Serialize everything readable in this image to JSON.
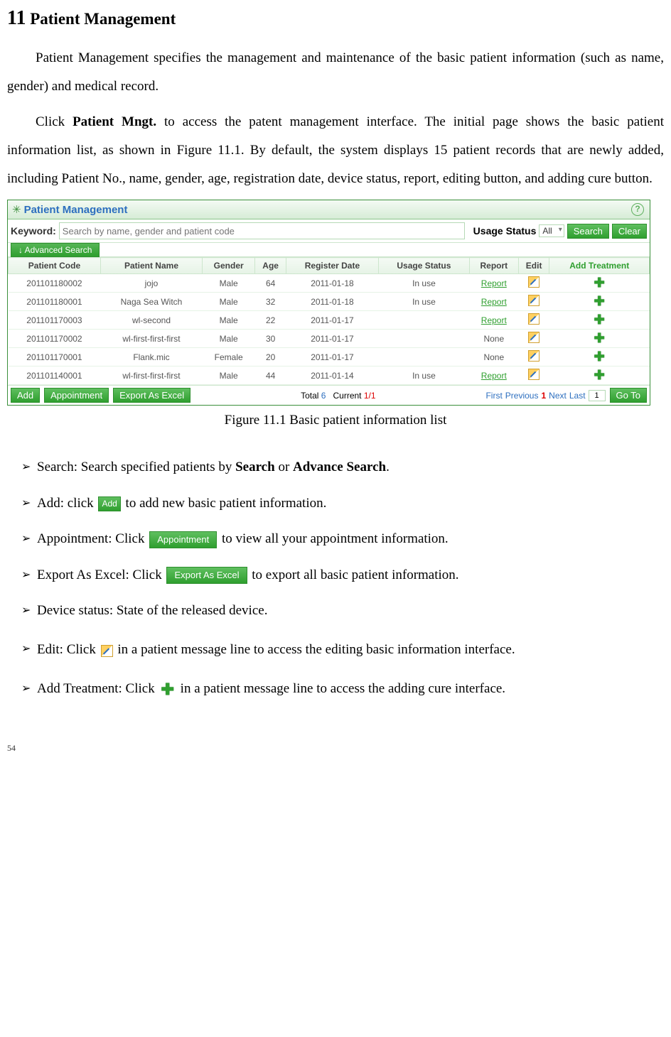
{
  "section": {
    "number": "11",
    "title": "Patient Management"
  },
  "para1": "Patient Management specifies the management and maintenance of the basic patient information (such as name, gender) and medical record.",
  "para2_a": "Click ",
  "para2_b": "Patient Mngt.",
  "para2_c": " to access the patent management interface. The initial page shows the basic patient information list, as shown in Figure 11.1.    By default, the system displays 15 patient records that are newly added, including Patient No., name, gender, age, registration date, device status, report, editing button, and adding cure button.",
  "panel": {
    "title": "Patient Management",
    "keyword_label": "Keyword:",
    "keyword_placeholder": "Search by name, gender and patient code",
    "usage_label": "Usage Status",
    "usage_value": "All",
    "search_btn": "Search",
    "clear_btn": "Clear",
    "adv_btn": "↓ Advanced Search",
    "headers": {
      "code": "Patient Code",
      "name": "Patient Name",
      "gender": "Gender",
      "age": "Age",
      "reg": "Register Date",
      "usage": "Usage Status",
      "report": "Report",
      "edit": "Edit",
      "add": "Add Treatment"
    },
    "rows": [
      {
        "code": "201101180002",
        "name": "jojo",
        "gender": "Male",
        "age": "64",
        "reg": "2011-01-18",
        "usage": "In use",
        "report": "Report"
      },
      {
        "code": "201101180001",
        "name": "Naga Sea Witch",
        "gender": "Male",
        "age": "32",
        "reg": "2011-01-18",
        "usage": "In use",
        "report": "Report"
      },
      {
        "code": "201101170003",
        "name": "wl-second",
        "gender": "Male",
        "age": "22",
        "reg": "2011-01-17",
        "usage": "",
        "report": "Report"
      },
      {
        "code": "201101170002",
        "name": "wl-first-first-first",
        "gender": "Male",
        "age": "30",
        "reg": "2011-01-17",
        "usage": "",
        "report": "None"
      },
      {
        "code": "201101170001",
        "name": "Flank.mic",
        "gender": "Female",
        "age": "20",
        "reg": "2011-01-17",
        "usage": "",
        "report": "None"
      },
      {
        "code": "201101140001",
        "name": "wl-first-first-first",
        "gender": "Male",
        "age": "44",
        "reg": "2011-01-14",
        "usage": "In use",
        "report": "Report"
      }
    ],
    "footer": {
      "add": "Add",
      "appt": "Appointment",
      "export": "Export As Excel",
      "total_lbl": "Total",
      "total_val": "6",
      "current_lbl": "Current",
      "current_val": "1/1",
      "first": "First",
      "prev": "Previous",
      "page": "1",
      "next": "Next",
      "last": "Last",
      "goto_input": "1",
      "goto_btn": "Go To"
    }
  },
  "caption": "Figure 11.1 Basic patient information list",
  "bullets": {
    "search_a": "Search: Search specified patients by ",
    "search_b": "Search",
    "search_c": " or ",
    "search_d": "Advance Search",
    "search_e": ".",
    "add_a": "Add: click ",
    "add_btn": "Add",
    "add_b": " to add new basic patient information.",
    "appt_a": "Appointment: Click ",
    "appt_btn": "Appointment",
    "appt_b": " to view all your appointment information.",
    "export_a": "Export As Excel: Click ",
    "export_btn": "Export As Excel",
    "export_b": " to export all basic patient information.",
    "device": "Device status: State of the released device.",
    "edit_a": "Edit: Click ",
    "edit_b": " in a patient message line to access the editing basic information interface.",
    "addtreat_a": "Add Treatment: Click ",
    "addtreat_b": "  in a patient message line to access the adding cure interface."
  },
  "page_number": "54"
}
